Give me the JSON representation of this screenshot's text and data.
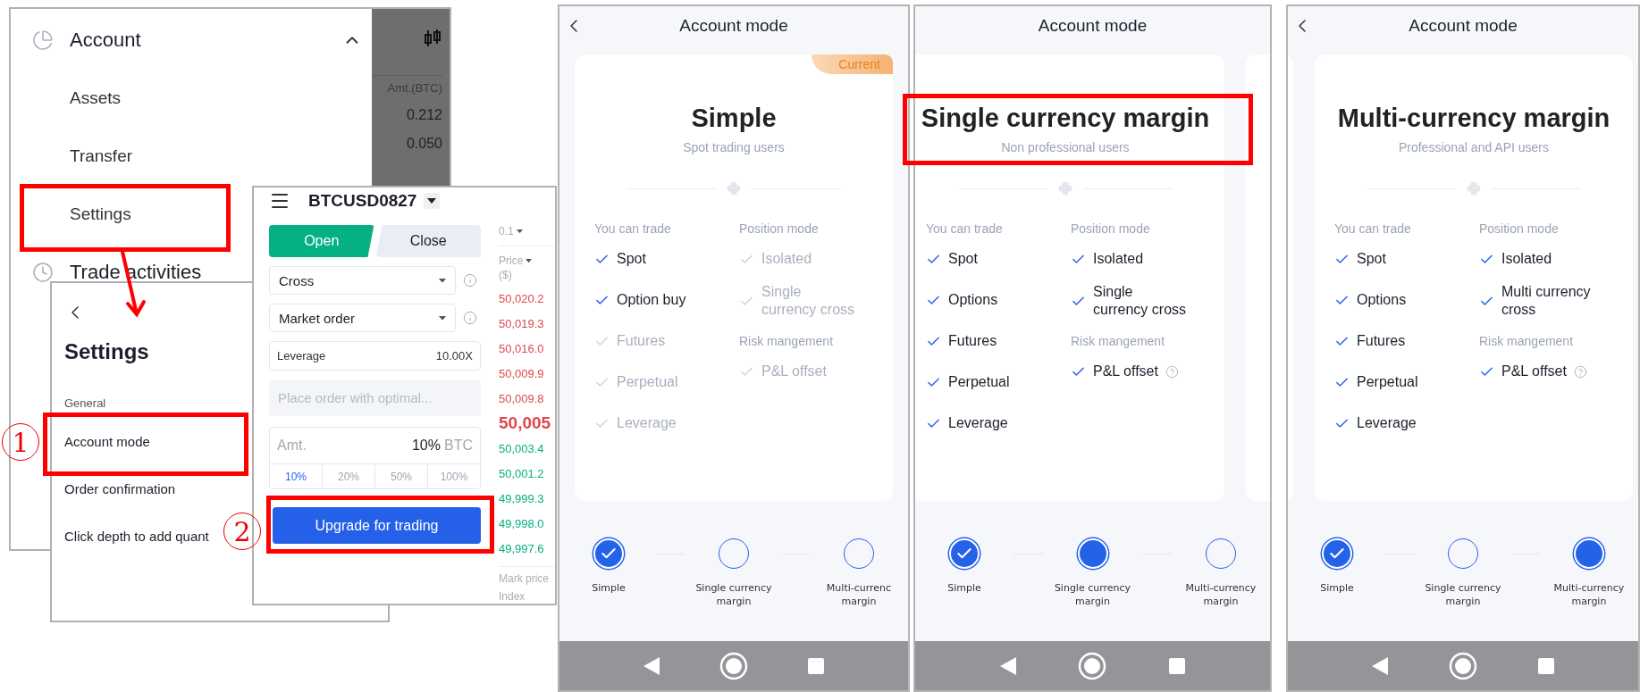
{
  "account_menu": {
    "items": [
      {
        "kind": "section",
        "label": "Account",
        "expanded": true
      },
      {
        "kind": "item",
        "label": "Assets"
      },
      {
        "kind": "item",
        "label": "Transfer"
      },
      {
        "kind": "item",
        "label": "Settings"
      },
      {
        "kind": "section",
        "label": "Trade activities"
      }
    ],
    "amount_header": "Amt.(BTC)",
    "amounts": [
      "0.212",
      "0.050"
    ]
  },
  "settings_panel": {
    "title": "Settings",
    "group": "General",
    "items": [
      "Account mode",
      "Order confirmation",
      "Click depth to add quant"
    ]
  },
  "order_panel": {
    "symbol": "BTCUSD0827",
    "tabs": [
      {
        "label": "Open",
        "selected": true
      },
      {
        "label": "Close",
        "selected": false
      }
    ],
    "selects": [
      "Cross",
      "Market order"
    ],
    "leverage": {
      "label": "Leverage",
      "value": "10.00X"
    },
    "order_field": {
      "placeholder": "Place order with optimal..."
    },
    "amount": {
      "label": "Amt.",
      "value": "10%",
      "unit": "BTC"
    },
    "percents": [
      {
        "label": "10%",
        "selected": true
      },
      {
        "label": "20%",
        "selected": false
      },
      {
        "label": "50%",
        "selected": false
      },
      {
        "label": "100%",
        "selected": false
      }
    ],
    "button": "Upgrade for trading",
    "book": {
      "tick": "0.1",
      "price_header": "Price",
      "price_unit": "($)",
      "prices": [
        {
          "kind": "ask",
          "value": "50,020.2"
        },
        {
          "kind": "ask",
          "value": "50,019.3"
        },
        {
          "kind": "ask",
          "value": "50,016.0"
        },
        {
          "kind": "ask",
          "value": "50,009.9"
        },
        {
          "kind": "ask",
          "value": "50,009.8"
        },
        {
          "kind": "last",
          "value": "50,005"
        },
        {
          "kind": "bid",
          "value": "50,003.4"
        },
        {
          "kind": "bid",
          "value": "50,001.2"
        },
        {
          "kind": "bid",
          "value": "49,999.3"
        },
        {
          "kind": "bid",
          "value": "49,998.0"
        },
        {
          "kind": "bid",
          "value": "49,997.6"
        }
      ],
      "footer": [
        "Mark price",
        "Index"
      ]
    }
  },
  "annotations": {
    "markers": [
      "1",
      "2"
    ]
  },
  "phones": [
    {
      "title": "Account mode",
      "back": true,
      "card": {
        "badge": "Current",
        "name": "Simple",
        "audience": "Spot trading users",
        "left": {
          "heading": "You can trade",
          "items": [
            {
              "label": "Spot",
              "enabled": true
            },
            {
              "label": "Option buy",
              "enabled": true
            },
            {
              "label": "Futures",
              "enabled": false
            },
            {
              "label": "Perpetual",
              "enabled": false
            },
            {
              "label": "Leverage",
              "enabled": false
            }
          ]
        },
        "right": [
          {
            "heading": "Position mode",
            "items": [
              {
                "label": "Isolated",
                "enabled": false
              },
              {
                "label": "Single\ncurrency cross",
                "enabled": false
              }
            ]
          },
          {
            "heading": "Risk mangement",
            "items": [
              {
                "label": "P&L offset",
                "enabled": false
              }
            ]
          }
        ]
      },
      "steps": [
        {
          "kind": "done",
          "label": "Simple"
        },
        {
          "kind": "todo",
          "label": "Single currency\nmargin"
        },
        {
          "kind": "todo",
          "label": "Multi-currenc\nmargin"
        }
      ]
    },
    {
      "title": "Account mode",
      "back": false,
      "card": {
        "name": "Single currency margin",
        "audience": "Non professional users",
        "left": {
          "heading": "You can trade",
          "items": [
            {
              "label": "Spot",
              "enabled": true
            },
            {
              "label": "Options",
              "enabled": true
            },
            {
              "label": "Futures",
              "enabled": true
            },
            {
              "label": "Perpetual",
              "enabled": true
            },
            {
              "label": "Leverage",
              "enabled": true
            }
          ]
        },
        "right": [
          {
            "heading": "Position mode",
            "items": [
              {
                "label": "Isolated",
                "enabled": true
              },
              {
                "label": "Single\ncurrency cross",
                "enabled": true
              }
            ]
          },
          {
            "heading": "Risk mangement",
            "items": [
              {
                "label": "P&L offset",
                "enabled": true,
                "help": true
              }
            ]
          }
        ]
      },
      "steps": [
        {
          "kind": "done",
          "label": "Simple"
        },
        {
          "kind": "current",
          "label": "Single currency\nmargin"
        },
        {
          "kind": "todo",
          "label": "Multi-currency\nmargin"
        }
      ]
    },
    {
      "title": "Account mode",
      "back": true,
      "card": {
        "name": "Multi-currency margin",
        "audience": "Professional and API users",
        "left": {
          "heading": "You can trade",
          "items": [
            {
              "label": "Spot",
              "enabled": true
            },
            {
              "label": "Options",
              "enabled": true
            },
            {
              "label": "Futures",
              "enabled": true
            },
            {
              "label": "Perpetual",
              "enabled": true
            },
            {
              "label": "Leverage",
              "enabled": true
            }
          ]
        },
        "right": [
          {
            "heading": "Position mode",
            "items": [
              {
                "label": "Isolated",
                "enabled": true
              },
              {
                "label": "Multi currency\ncross",
                "enabled": true
              }
            ]
          },
          {
            "heading": "Risk mangement",
            "items": [
              {
                "label": "P&L offset",
                "enabled": true,
                "help": true
              }
            ]
          }
        ]
      },
      "steps": [
        {
          "kind": "done",
          "label": "Simple"
        },
        {
          "kind": "todo",
          "label": "Single currency\nmargin"
        },
        {
          "kind": "current",
          "label": "Multi-currency\nmargin"
        }
      ]
    }
  ]
}
